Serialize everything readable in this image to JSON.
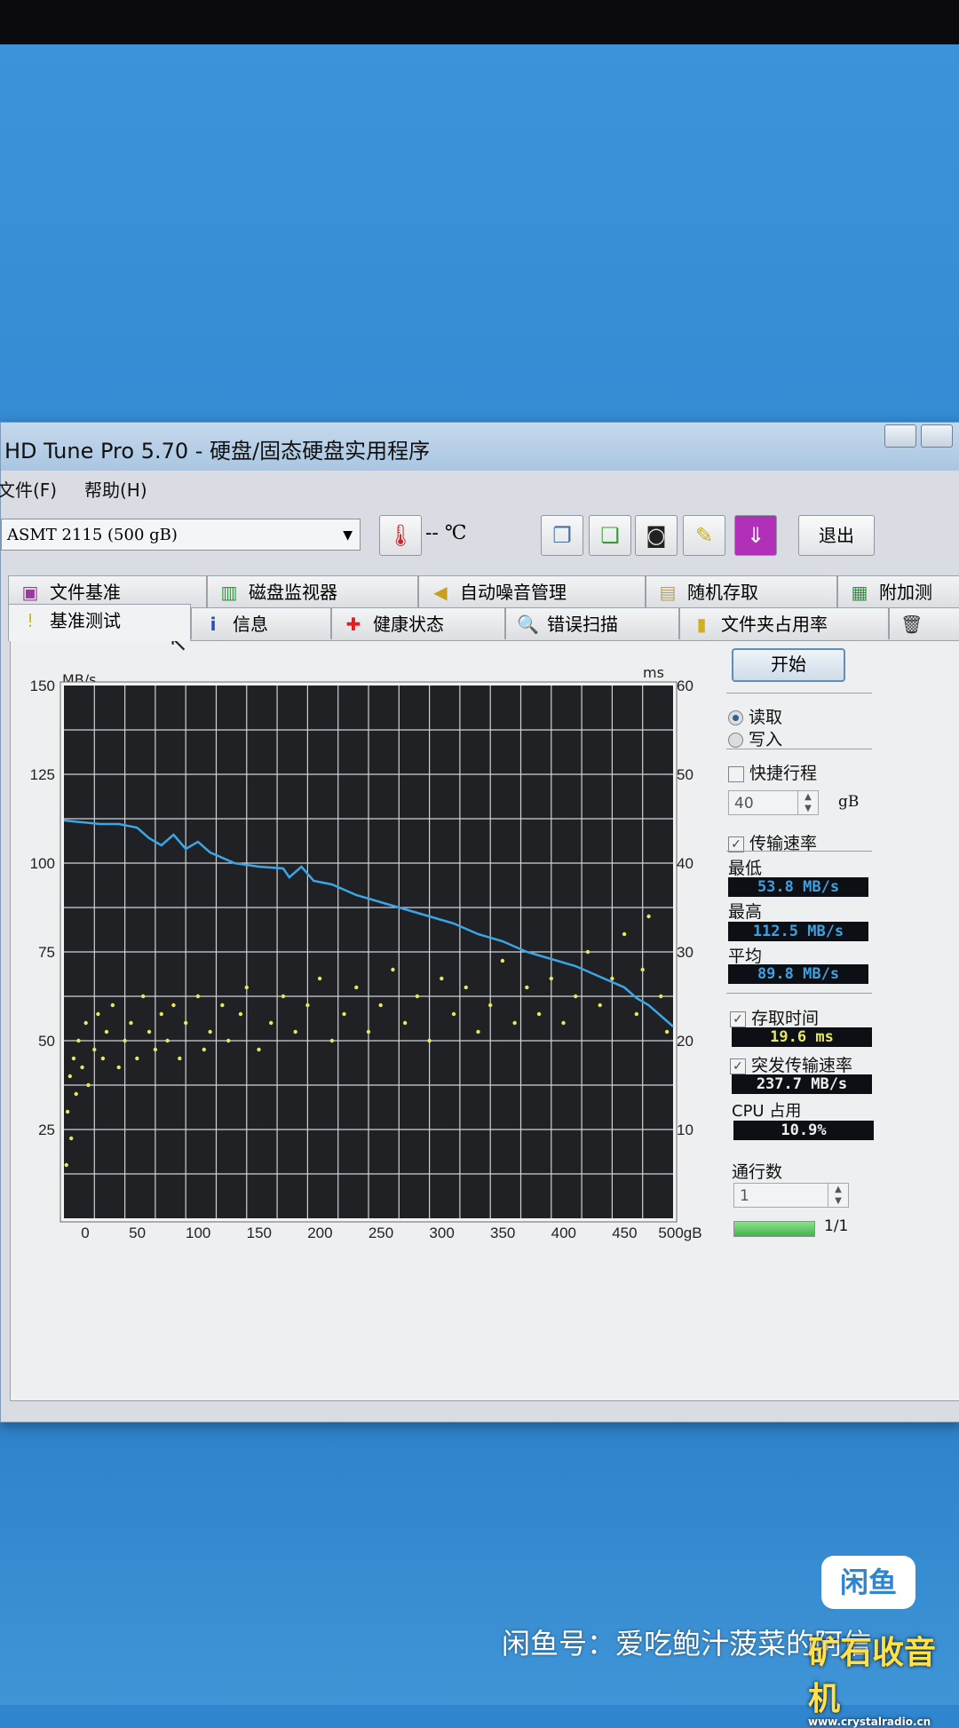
{
  "window": {
    "title": "HD Tune Pro 5.70 - 硬盘/固态硬盘实用程序"
  },
  "menu": [
    "文件(F)",
    "帮助(H)"
  ],
  "toolbar": {
    "drive": "ASMT    2115 (500 gB)",
    "temperature": "-- ℃",
    "exit_label": "退出"
  },
  "tabs_row1": [
    "文件基准",
    "磁盘监视器",
    "自动噪音管理",
    "随机存取",
    "附加测"
  ],
  "tabs_row2": [
    "基准测试",
    "信息",
    "健康状态",
    "错误扫描",
    "文件夹占用率",
    ""
  ],
  "controls": {
    "start": "开始",
    "read": "读取",
    "write": "写入",
    "short_stroke": "快捷行程",
    "short_stroke_value": "40",
    "short_stroke_unit": "gB",
    "transfer_rate": "传输速率",
    "min_label": "最低",
    "min_value": "53.8 MB/s",
    "max_label": "最高",
    "max_value": "112.5 MB/s",
    "avg_label": "平均",
    "avg_value": "89.8 MB/s",
    "access_time": "存取时间",
    "access_value": "19.6 ms",
    "burst_rate": "突发传输速率",
    "burst_value": "237.7 MB/s",
    "cpu_label": "CPU 占用",
    "cpu_value": "10.9%",
    "passes_label": "通行数",
    "passes_value": "1",
    "progress_text": "1/1",
    "progress": 1.0
  },
  "colors": {
    "line": "#3aa6e6",
    "dots": "#e8e860",
    "plot_bg": "#1f2124",
    "grid": "#cfd3d6"
  },
  "chart_data": {
    "type": "line",
    "ylabel_left": "MB/s",
    "ylabel_right": "ms",
    "xlabel": "gB",
    "xlim": [
      0,
      500
    ],
    "ylim_left": [
      0,
      150
    ],
    "ylim_right": [
      0,
      60
    ],
    "xticks": [
      "0",
      "50",
      "100",
      "150",
      "200",
      "250",
      "300",
      "350",
      "400",
      "450",
      "500gB"
    ],
    "yticks_left": [
      "150",
      "125",
      "100",
      "75",
      "50",
      "25"
    ],
    "yticks_right": [
      "60",
      "50",
      "40",
      "30",
      "20",
      "10"
    ],
    "series": [
      {
        "name": "传输速率",
        "unit": "MB/s",
        "points": [
          [
            0,
            112
          ],
          [
            15,
            111.5
          ],
          [
            30,
            111
          ],
          [
            45,
            111
          ],
          [
            60,
            110
          ],
          [
            70,
            107
          ],
          [
            80,
            105
          ],
          [
            90,
            108
          ],
          [
            100,
            104
          ],
          [
            110,
            106
          ],
          [
            120,
            103
          ],
          [
            140,
            100
          ],
          [
            160,
            99
          ],
          [
            180,
            98.5
          ],
          [
            185,
            96
          ],
          [
            195,
            99
          ],
          [
            205,
            95
          ],
          [
            220,
            94
          ],
          [
            240,
            91
          ],
          [
            260,
            89
          ],
          [
            280,
            87
          ],
          [
            300,
            85
          ],
          [
            320,
            83
          ],
          [
            340,
            80
          ],
          [
            360,
            78
          ],
          [
            380,
            75
          ],
          [
            400,
            73
          ],
          [
            420,
            71
          ],
          [
            440,
            68
          ],
          [
            460,
            65
          ],
          [
            470,
            62
          ],
          [
            480,
            60
          ],
          [
            490,
            57
          ],
          [
            500,
            54
          ]
        ]
      },
      {
        "name": "存取时间",
        "unit": "ms",
        "type": "scatter",
        "points": [
          [
            2,
            6
          ],
          [
            3,
            12
          ],
          [
            5,
            16
          ],
          [
            6,
            9
          ],
          [
            8,
            18
          ],
          [
            10,
            14
          ],
          [
            12,
            20
          ],
          [
            15,
            17
          ],
          [
            18,
            22
          ],
          [
            20,
            15
          ],
          [
            25,
            19
          ],
          [
            28,
            23
          ],
          [
            32,
            18
          ],
          [
            35,
            21
          ],
          [
            40,
            24
          ],
          [
            45,
            17
          ],
          [
            50,
            20
          ],
          [
            55,
            22
          ],
          [
            60,
            18
          ],
          [
            65,
            25
          ],
          [
            70,
            21
          ],
          [
            75,
            19
          ],
          [
            80,
            23
          ],
          [
            85,
            20
          ],
          [
            90,
            24
          ],
          [
            95,
            18
          ],
          [
            100,
            22
          ],
          [
            110,
            25
          ],
          [
            115,
            19
          ],
          [
            120,
            21
          ],
          [
            130,
            24
          ],
          [
            135,
            20
          ],
          [
            145,
            23
          ],
          [
            150,
            26
          ],
          [
            160,
            19
          ],
          [
            170,
            22
          ],
          [
            180,
            25
          ],
          [
            190,
            21
          ],
          [
            200,
            24
          ],
          [
            210,
            27
          ],
          [
            220,
            20
          ],
          [
            230,
            23
          ],
          [
            240,
            26
          ],
          [
            250,
            21
          ],
          [
            260,
            24
          ],
          [
            270,
            28
          ],
          [
            280,
            22
          ],
          [
            290,
            25
          ],
          [
            300,
            20
          ],
          [
            310,
            27
          ],
          [
            320,
            23
          ],
          [
            330,
            26
          ],
          [
            340,
            21
          ],
          [
            350,
            24
          ],
          [
            360,
            29
          ],
          [
            370,
            22
          ],
          [
            380,
            26
          ],
          [
            390,
            23
          ],
          [
            400,
            27
          ],
          [
            410,
            22
          ],
          [
            420,
            25
          ],
          [
            430,
            30
          ],
          [
            440,
            24
          ],
          [
            450,
            27
          ],
          [
            460,
            32
          ],
          [
            470,
            23
          ],
          [
            475,
            28
          ],
          [
            480,
            34
          ],
          [
            490,
            25
          ],
          [
            495,
            21
          ]
        ]
      }
    ]
  },
  "watermark": {
    "text": "闲鱼号：爱吃鲍汁菠菜的阿信",
    "logo": "闲鱼",
    "site": "矿石收音机",
    "site_url": "www.crystalradio.cn"
  }
}
